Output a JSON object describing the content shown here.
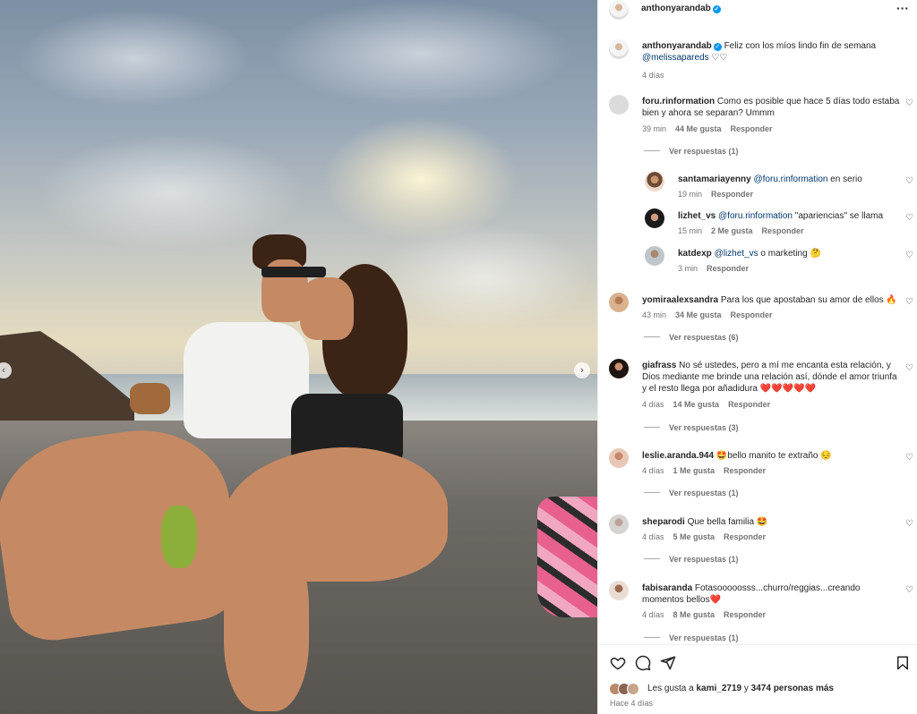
{
  "post": {
    "username": "anthonyarandab",
    "more_icon": "more-icon"
  },
  "caption": {
    "username": "anthonyarandab",
    "text": "Feliz con los míos lindo fin de semana",
    "mention": "@melissapareds",
    "suffix": "♡♡",
    "time": "4 días"
  },
  "comments": [
    {
      "username": "foru.rinformation",
      "text": "Como es posible que hace 5 días todo estaba bien y ahora se separan? Ummm",
      "time": "39 min",
      "likes": "44 Me gusta",
      "reply": "Responder",
      "view_replies": "Ver respuestas (1)"
    },
    {
      "username": "santamariayenny",
      "mention": "@foru.rinformation",
      "text": "en serio",
      "time": "19 min",
      "reply": "Responder"
    },
    {
      "username": "lizhet_vs",
      "mention": "@foru.rinformation",
      "text": "\"apariencias\" se llama",
      "time": "15 min",
      "likes": "2 Me gusta",
      "reply": "Responder"
    },
    {
      "username": "katdexp",
      "mention": "@lizhet_vs",
      "text": "o marketing 🤔",
      "time": "3 min",
      "reply": "Responder"
    },
    {
      "username": "yomiraalexsandra",
      "text": "Para los que apostaban su amor de ellos 🔥",
      "time": "43 min",
      "likes": "34 Me gusta",
      "reply": "Responder",
      "view_replies": "Ver respuestas (6)"
    },
    {
      "username": "giafrass",
      "text": "No sé ustedes, pero a mí me encanta esta relación, y Dios mediante me brinde una relación así, dónde el amor triunfa y el resto llega por añadidura ❤️❤️❤️❤️❤️",
      "time": "4 días",
      "likes": "14 Me gusta",
      "reply": "Responder",
      "view_replies": "Ver respuestas (3)"
    },
    {
      "username": "leslie.aranda.944",
      "text": "🤩bello manito te extraño 😔",
      "time": "4 días",
      "likes": "1 Me gusta",
      "reply": "Responder",
      "view_replies": "Ver respuestas (1)"
    },
    {
      "username": "sheparodi",
      "text": "Que bella familia 🤩",
      "time": "4 días",
      "likes": "5 Me gusta",
      "reply": "Responder",
      "view_replies": "Ver respuestas (1)"
    },
    {
      "username": "fabisaranda",
      "text": "Fotasooooosss...churro/reggias...creando momentos bellos❤️",
      "time": "4 días",
      "likes": "8 Me gusta",
      "reply": "Responder",
      "view_replies": "Ver respuestas (1)"
    }
  ],
  "footer": {
    "likes_prefix": "Les gusta a",
    "likes_user": "kami_2719",
    "likes_mid": "y",
    "likes_count": "3474 personas más",
    "date": "Hace 4 días"
  },
  "icons": {
    "like": "heart-icon",
    "comment": "comment-icon",
    "share": "share-icon",
    "save": "bookmark-icon",
    "prev": "chevron-left-icon",
    "next": "chevron-right-icon"
  },
  "colors": {
    "verified": "#0095f6",
    "mention": "#00376b",
    "meta": "#737373"
  }
}
